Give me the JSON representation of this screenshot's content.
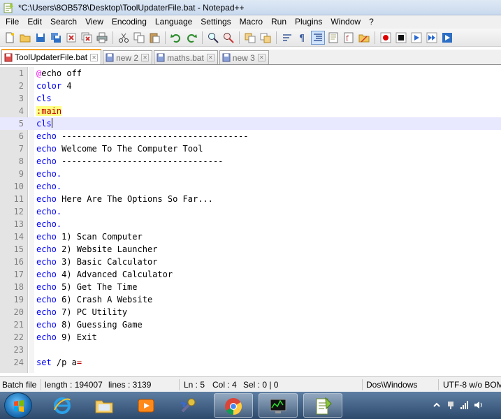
{
  "window": {
    "title": "*C:\\Users\\8OB578\\Desktop\\ToolUpdaterFile.bat - Notepad++"
  },
  "menu": [
    "File",
    "Edit",
    "Search",
    "View",
    "Encoding",
    "Language",
    "Settings",
    "Macro",
    "Run",
    "Plugins",
    "Window",
    "?"
  ],
  "tabs": [
    {
      "label": "ToolUpdaterFile.bat",
      "active": true
    },
    {
      "label": "new  2",
      "active": false
    },
    {
      "label": "maths.bat",
      "active": false
    },
    {
      "label": "new  3",
      "active": false
    }
  ],
  "editor": {
    "current_line": 5,
    "lines": [
      {
        "num": "1",
        "kw": "@",
        "rest": "echo off"
      },
      {
        "num": "2",
        "kw": "color",
        "rest": " 4"
      },
      {
        "num": "3",
        "kw": "cls",
        "rest": ""
      },
      {
        "num": "4",
        "kw": ":main",
        "rest": ""
      },
      {
        "num": "5",
        "kw": "cls",
        "rest": ""
      },
      {
        "num": "6",
        "kw": "echo",
        "rest": " -------------------------------------"
      },
      {
        "num": "7",
        "kw": "echo",
        "rest": " Welcome To The Computer Tool"
      },
      {
        "num": "8",
        "kw": "echo",
        "rest": " --------------------------------"
      },
      {
        "num": "9",
        "kw": "echo.",
        "rest": ""
      },
      {
        "num": "10",
        "kw": "echo.",
        "rest": ""
      },
      {
        "num": "11",
        "kw": "echo",
        "rest": " Here Are The Options So Far..."
      },
      {
        "num": "12",
        "kw": "echo.",
        "rest": ""
      },
      {
        "num": "13",
        "kw": "echo.",
        "rest": ""
      },
      {
        "num": "14",
        "kw": "echo",
        "rest": " 1) Scan Computer"
      },
      {
        "num": "15",
        "kw": "echo",
        "rest": " 2) Website Launcher"
      },
      {
        "num": "16",
        "kw": "echo",
        "rest": " 3) Basic Calculator"
      },
      {
        "num": "17",
        "kw": "echo",
        "rest": " 4) Advanced Calculator"
      },
      {
        "num": "18",
        "kw": "echo",
        "rest": " 5) Get The Time"
      },
      {
        "num": "19",
        "kw": "echo",
        "rest": " 6) Crash A Website"
      },
      {
        "num": "20",
        "kw": "echo",
        "rest": " 7) PC Utility"
      },
      {
        "num": "21",
        "kw": "echo",
        "rest": " 8) Guessing Game"
      },
      {
        "num": "22",
        "kw": "echo",
        "rest": " 9) Exit"
      },
      {
        "num": "23",
        "kw": "",
        "rest": ""
      },
      {
        "num": "24",
        "kw": "set",
        "rest": " /p a="
      }
    ]
  },
  "status": {
    "language": "Batch file",
    "length": "length : 194007",
    "lines": "lines : 3139",
    "ln": "Ln : 5",
    "col": "Col : 4",
    "sel": "Sel : 0 | 0",
    "eol": "Dos\\Windows",
    "encoding": "UTF-8 w/o BOM"
  },
  "taskbar": {
    "apps": [
      "internet-explorer",
      "file-explorer",
      "media-player",
      "system-tool",
      "chrome",
      "task-manager",
      "notepad-plus-plus"
    ]
  },
  "colors": {
    "keyword": "#0000ff",
    "label": "#c00000",
    "label_bg": "#ffff80",
    "current_line_bg": "#e8e8ff",
    "tab_accent": "#f7a42b"
  }
}
